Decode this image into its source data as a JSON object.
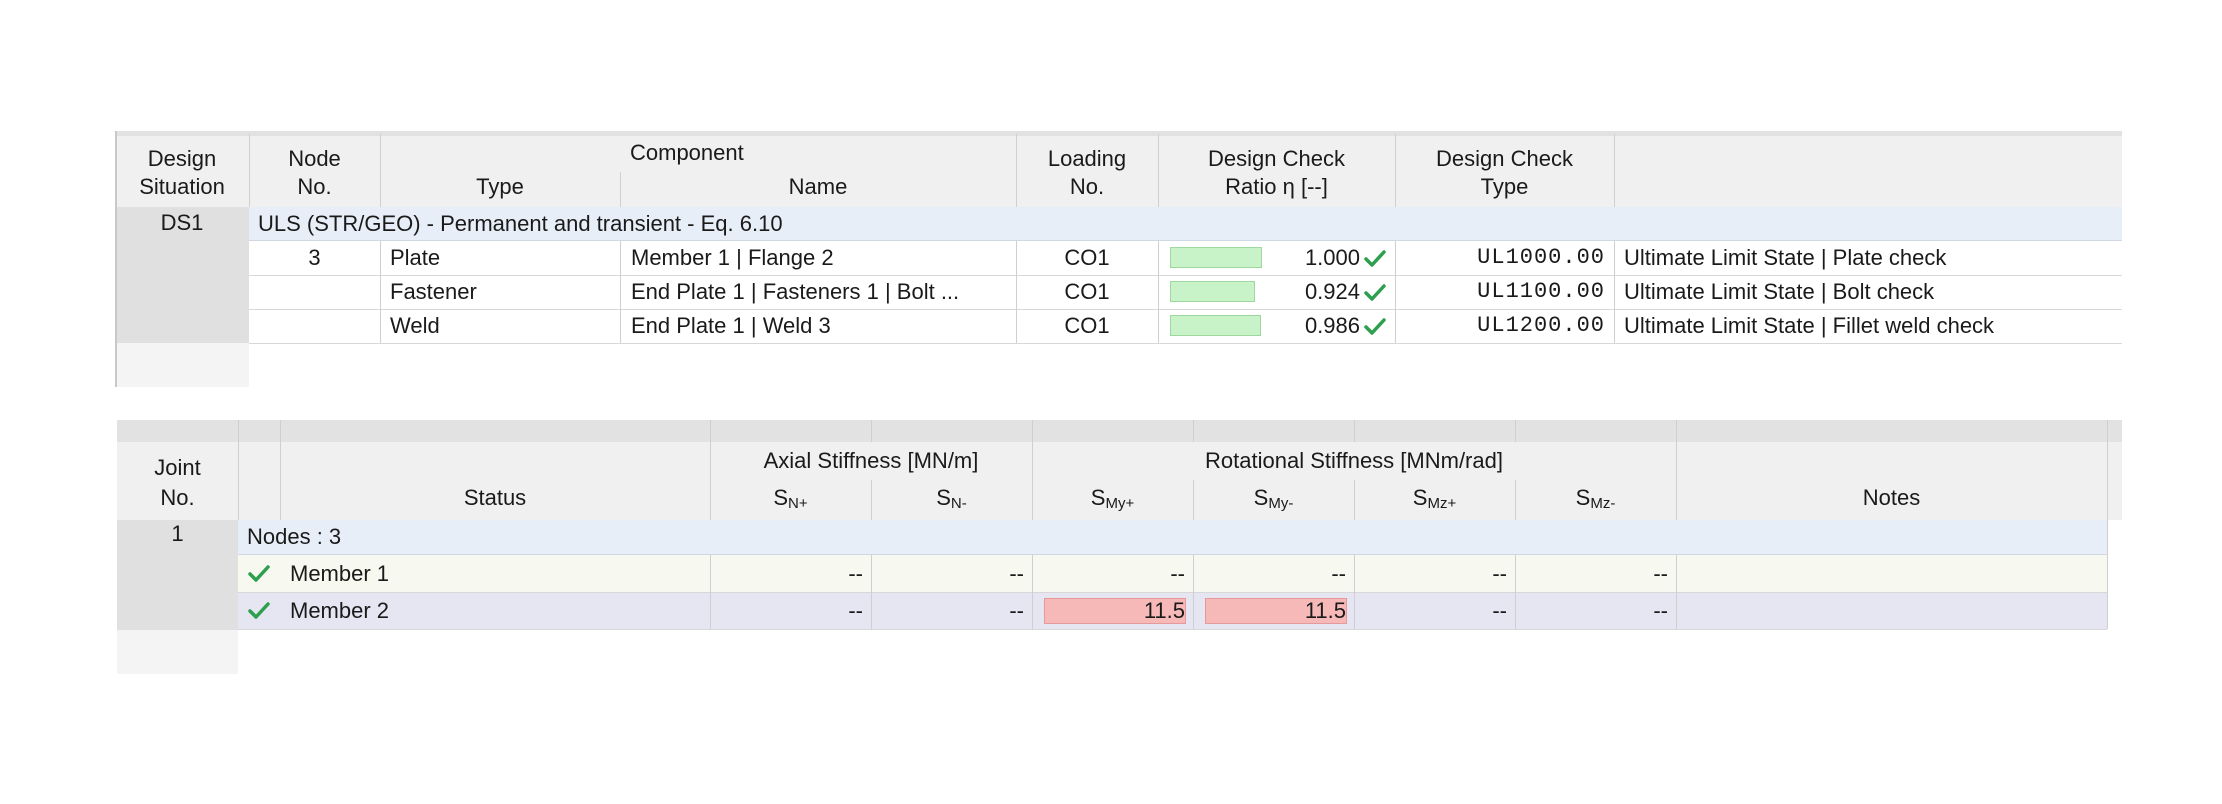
{
  "table1": {
    "headers": {
      "design_situation_1": "Design",
      "design_situation_2": "Situation",
      "node_1": "Node",
      "node_2": "No.",
      "component": "Component",
      "type": "Type",
      "name": "Name",
      "loading_1": "Loading",
      "loading_2": "No.",
      "ratio_1": "Design Check",
      "ratio_2": "Ratio η [--]",
      "check_type_1": "Design Check",
      "check_type_2": "Type"
    },
    "situation": "DS1",
    "group_label": "ULS (STR/GEO) - Permanent and transient - Eq. 6.10",
    "rows": [
      {
        "node": "3",
        "type": "Plate",
        "name": "Member 1 | Flange 2",
        "loading": "CO1",
        "ratio": "1.000",
        "ratio_value": 1.0,
        "code": "UL1000.00",
        "description": "Ultimate Limit State | Plate check"
      },
      {
        "node": "",
        "type": "Fastener",
        "name": "End Plate 1 | Fasteners 1 | Bolt ...",
        "loading": "CO1",
        "ratio": "0.924",
        "ratio_value": 0.924,
        "code": "UL1100.00",
        "description": "Ultimate Limit State | Bolt check"
      },
      {
        "node": "",
        "type": "Weld",
        "name": "End Plate 1 | Weld 3",
        "loading": "CO1",
        "ratio": "0.986",
        "ratio_value": 0.986,
        "code": "UL1200.00",
        "description": "Ultimate Limit State | Fillet weld check"
      }
    ]
  },
  "table2": {
    "headers": {
      "joint_1": "Joint",
      "joint_2": "No.",
      "status": "Status",
      "axial": "Axial Stiffness [MN/m]",
      "rotational": "Rotational Stiffness [MNm/rad]",
      "sn_plus": "S",
      "sn_plus_sub": "N+",
      "sn_minus": "S",
      "sn_minus_sub": "N-",
      "smy_plus": "S",
      "smy_plus_sub": "My+",
      "smy_minus": "S",
      "smy_minus_sub": "My-",
      "smz_plus": "S",
      "smz_plus_sub": "Mz+",
      "smz_minus": "S",
      "smz_minus_sub": "Mz-",
      "notes": "Notes"
    },
    "joint": "1",
    "group_label": "Nodes : 3",
    "rows": [
      {
        "member": "Member 1",
        "sn_plus": "--",
        "sn_minus": "--",
        "smy_plus": "--",
        "smy_minus": "--",
        "smz_plus": "--",
        "smz_minus": "--",
        "notes": ""
      },
      {
        "member": "Member 2",
        "sn_plus": "--",
        "sn_minus": "--",
        "smy_plus": "11.5",
        "smy_minus": "11.5",
        "smz_plus": "--",
        "smz_minus": "--",
        "notes": ""
      }
    ]
  },
  "colors": {
    "header_bg": "#f0f0f0",
    "group_bg": "#e8eef7",
    "ratio_bar": "#c8f2c8",
    "check_green": "#2e9e4f",
    "highlight_red": "#f7b8b8",
    "row_alt": "#e6e6f2"
  },
  "icons": {
    "ok": "check-icon"
  }
}
